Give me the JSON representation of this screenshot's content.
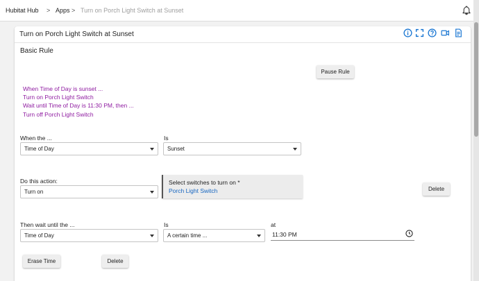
{
  "breadcrumb": {
    "hub": "Hubitat Hub",
    "apps": "Apps",
    "current": "Turn on Porch Light Switch at Sunset",
    "separator": ">"
  },
  "app": {
    "title": "Turn on Porch Light Switch at Sunset",
    "section_title": "Basic Rule"
  },
  "buttons": {
    "pause_rule": "Pause Rule",
    "delete_action": "Delete",
    "erase_time": "Erase Time",
    "delete_wait": "Delete"
  },
  "summary": [
    "When Time of Day is sunset ...",
    "Turn on Porch Light Switch",
    "Wait until Time of Day is 11:30 PM, then ...",
    "Turn off Porch Light Switch"
  ],
  "trigger": {
    "label": "When the ...",
    "value": "Time of Day",
    "is_label": "Is",
    "is_value": "Sunset"
  },
  "action": {
    "label": "Do this action:",
    "value": "Turn on",
    "switch_label": "Select switches to turn on *",
    "switch_value": "Porch Light Switch"
  },
  "wait": {
    "label": "Then wait until the ...",
    "value": "Time of Day",
    "is_label": "Is",
    "is_value": "A certain time ...",
    "at_label": "at",
    "time_value": "11:30  PM"
  },
  "colors": {
    "summary_text": "#8e1aa0",
    "icon_blue": "#1976d2",
    "link_blue": "#1565c0"
  },
  "icons": {
    "header": [
      "info-icon",
      "fullscreen-icon",
      "help-icon",
      "video-icon",
      "logs-icon"
    ],
    "topbar": "bell-icon",
    "time": "clock-icon"
  }
}
